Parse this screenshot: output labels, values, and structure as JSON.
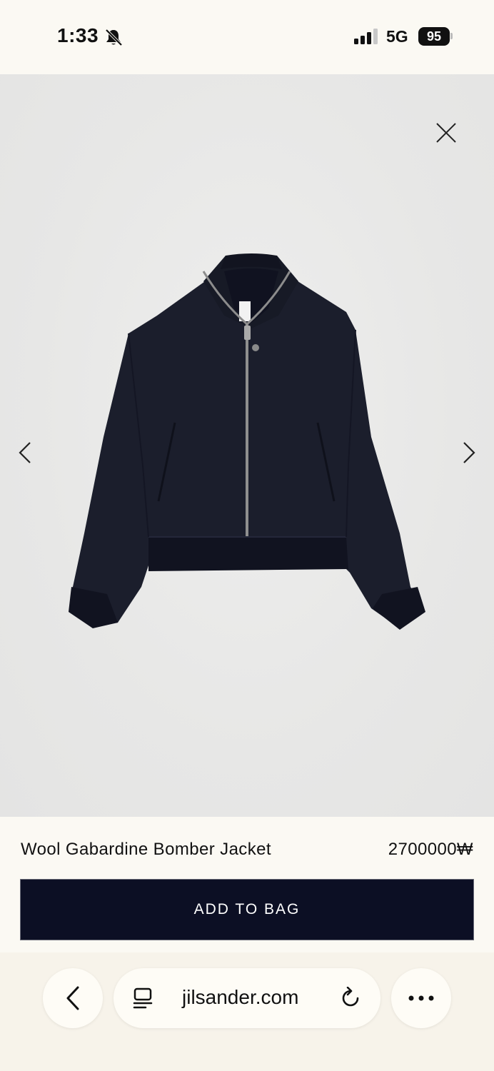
{
  "status_bar": {
    "time": "1:33",
    "network": "5G",
    "battery": "95",
    "icons": [
      "bell-muted-icon",
      "cellular-signal-icon",
      "battery-icon"
    ]
  },
  "gallery": {
    "image_subject": "Wool Gabardine Bomber Jacket",
    "icons": [
      "close-icon",
      "chevron-left-icon",
      "chevron-right-icon"
    ],
    "background_color": "#e9e9e8",
    "jacket_color": "#1a1d2b"
  },
  "product": {
    "name": "Wool Gabardine Bomber Jacket",
    "price": "2700000₩",
    "add_to_bag_label": "ADD TO BAG",
    "button_color": "#0c0f24"
  },
  "browser": {
    "url": "jilsander.com",
    "icons": [
      "chevron-left-icon",
      "reader-mode-icon",
      "reload-icon",
      "more-icon"
    ]
  }
}
